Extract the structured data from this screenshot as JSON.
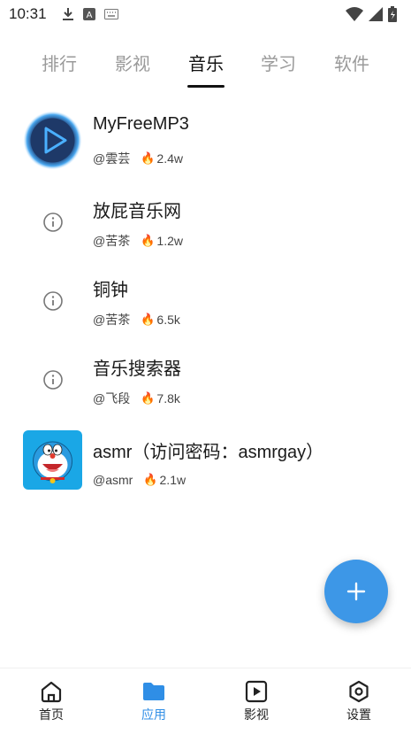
{
  "status_bar": {
    "time": "10:31"
  },
  "tabs": [
    {
      "label": "排行",
      "active": false
    },
    {
      "label": "影视",
      "active": false
    },
    {
      "label": "音乐",
      "active": true
    },
    {
      "label": "学习",
      "active": false
    },
    {
      "label": "软件",
      "active": false
    }
  ],
  "items": [
    {
      "title": "MyFreeMP3",
      "author": "@雲芸",
      "heat": "2.4w",
      "icon": "play-logo-icon"
    },
    {
      "title": "放屁音乐网",
      "author": "@苦茶",
      "heat": "1.2w",
      "icon": "info-icon"
    },
    {
      "title": "铜钟",
      "author": "@苦茶",
      "heat": "6.5k",
      "icon": "info-icon"
    },
    {
      "title": "音乐搜索器",
      "author": "@飞段",
      "heat": "7.8k",
      "icon": "info-icon"
    },
    {
      "title": "asmr（访问密码：asmrgay）",
      "author": "@asmr",
      "heat": "2.1w",
      "icon": "doraemon-icon"
    }
  ],
  "fab": {
    "icon": "plus-icon"
  },
  "bottom_nav": [
    {
      "label": "首页",
      "icon": "home-icon",
      "active": false
    },
    {
      "label": "应用",
      "icon": "folder-icon",
      "active": true
    },
    {
      "label": "影视",
      "icon": "video-icon",
      "active": false
    },
    {
      "label": "设置",
      "icon": "settings-icon",
      "active": false
    }
  ],
  "colors": {
    "accent": "#3d97e7",
    "nav_active": "#2f8ee6",
    "tab_inactive": "#9a9a9a"
  }
}
